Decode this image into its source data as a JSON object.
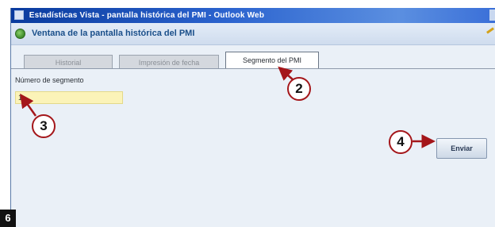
{
  "window": {
    "title": "Estadísticas Vista - pantalla histórica del PMI - Outlook Web"
  },
  "panel": {
    "title": "Ventana de la pantalla histórica del PMI"
  },
  "tabs": [
    {
      "label": "Historial",
      "state": "inactive"
    },
    {
      "label": "Impresión de fecha",
      "state": "inactive"
    },
    {
      "label": "Segmento del PMI",
      "state": "active"
    }
  ],
  "form": {
    "field_label": "Número de segmento",
    "field_value": "1"
  },
  "actions": {
    "send_label": "Enviar"
  },
  "callouts": {
    "tab": "2",
    "field": "3",
    "button": "4"
  },
  "figure": {
    "number": "6"
  },
  "colors": {
    "titlebar": "#0a3b9e",
    "callout_ring": "#a4161a",
    "arrow": "#a4161a",
    "input_fill": "#fbf3b8"
  },
  "icons": {
    "titlebar": "app-window-icon",
    "panel": "globe-icon",
    "header_edit": "pencil-icon"
  }
}
